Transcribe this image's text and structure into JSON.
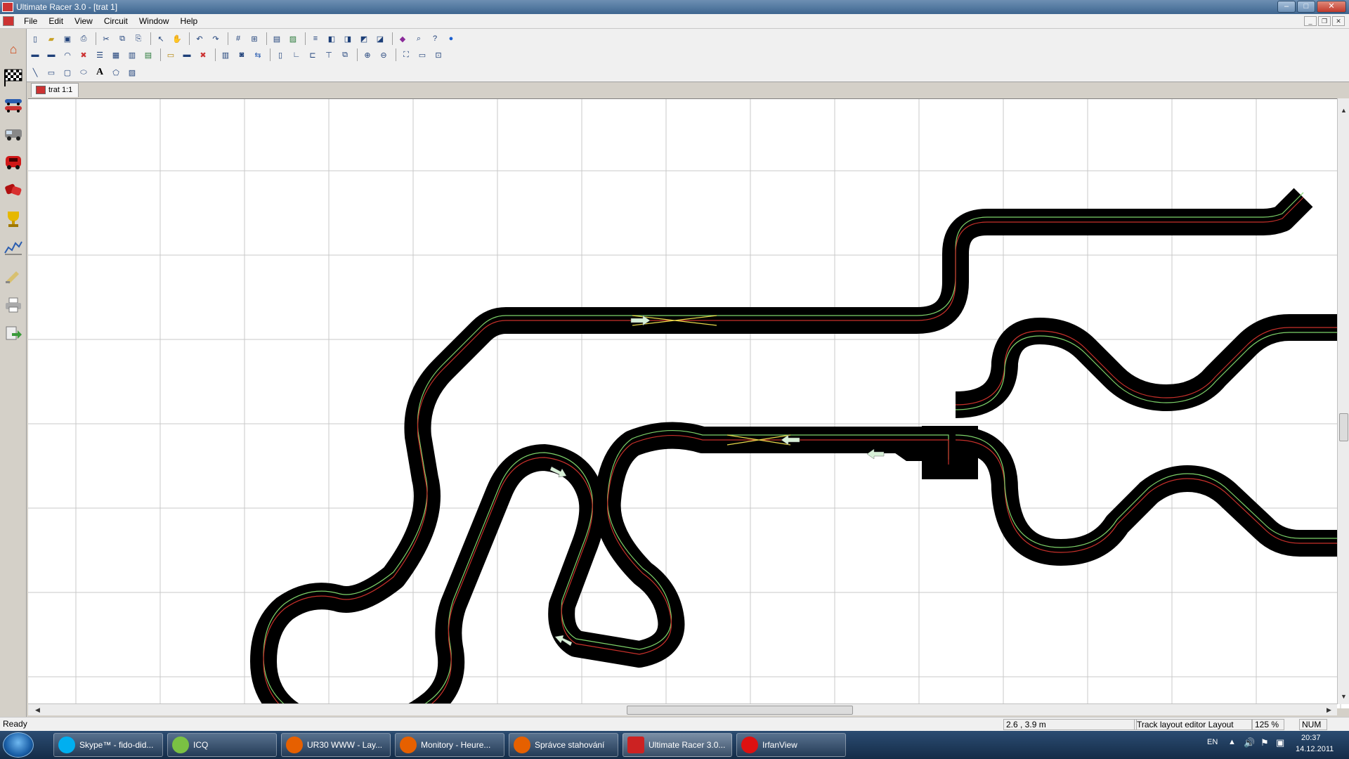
{
  "window": {
    "title": "Ultimate Racer 3.0 - [trat 1]",
    "buttons": [
      "–",
      "□",
      "✕"
    ]
  },
  "menu": [
    "File",
    "Edit",
    "View",
    "Circuit",
    "Window",
    "Help"
  ],
  "document_tab": "trat 1:1",
  "status": {
    "ready": "Ready",
    "coords": "2.6 , 3.9 m",
    "mode": "Track layout editor Layout edit",
    "zoom": "125 %",
    "num": "NUM"
  },
  "sidebar_icons": [
    "home-icon",
    "checkered-flag-icon",
    "race-cars-icon",
    "truck-icon",
    "red-car-icon",
    "crash-icon",
    "trophy-icon",
    "chart-icon",
    "pen-icon",
    "printer-icon",
    "export-icon"
  ],
  "taskbar": {
    "items": [
      {
        "label": "Skype™ - fido-did...",
        "color": "#00aff0"
      },
      {
        "label": "ICQ",
        "color": "#7ac143"
      },
      {
        "label": "UR30 WWW - Lay...",
        "color": "#e66000"
      },
      {
        "label": "Monitory - Heure...",
        "color": "#e66000"
      },
      {
        "label": "Správce stahování",
        "color": "#e66000"
      },
      {
        "label": "Ultimate Racer 3.0...",
        "color": "#cc2222"
      },
      {
        "label": "IrfanView",
        "color": "#dd1111"
      }
    ],
    "lang": "EN",
    "time": "20:37",
    "date": "14.12.2011"
  },
  "colors": {
    "track": "#000000",
    "lane_red": "#c8302a",
    "lane_green": "#7ed36a",
    "lane_yellow": "#e8d84a",
    "grid": "#c8c8c8"
  }
}
